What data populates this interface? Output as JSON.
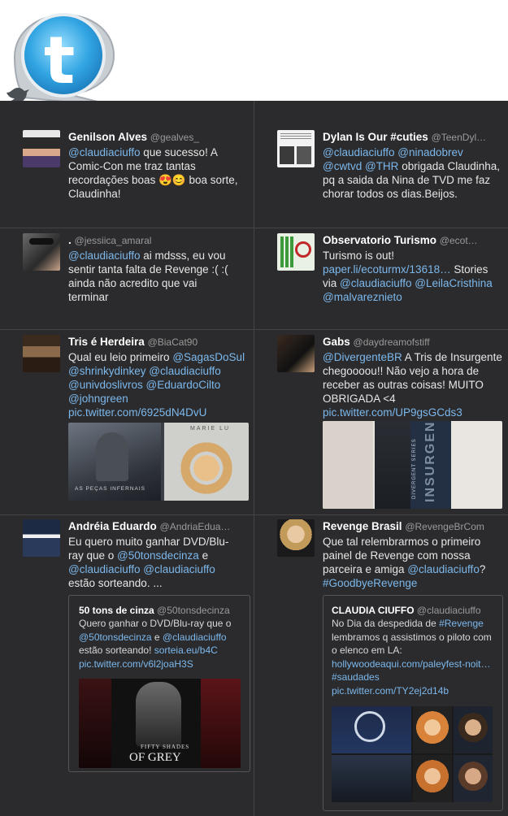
{
  "tweets": [
    {
      "name": "Genilson Alves",
      "handle": "@gealves_",
      "parts": [
        [
          "m",
          "@claudiaciuffo"
        ],
        [
          "t",
          " que sucesso! A Comic-Con me traz tantas recordações boas "
        ],
        [
          "t",
          "😍😊"
        ],
        [
          "t",
          " boa sorte, Claudinha!"
        ]
      ]
    },
    {
      "name": "Dylan Is Our #cuties",
      "handle": "@TeenDyl…",
      "parts": [
        [
          "m",
          "@claudiaciuffo"
        ],
        [
          "t",
          " "
        ],
        [
          "m",
          "@ninadobrev"
        ],
        [
          "t",
          " "
        ],
        [
          "m",
          "@cwtvd"
        ],
        [
          "t",
          " "
        ],
        [
          "m",
          "@THR"
        ],
        [
          "t",
          " obrigada Claudinha, pq a saida da Nina de TVD me faz chorar todos os dias.Beijos."
        ]
      ]
    },
    {
      "name": ".",
      "handle": "@jessiica_amaral",
      "parts": [
        [
          "m",
          "@claudiaciuffo"
        ],
        [
          "t",
          " ai mdsss, eu vou sentir tanta falta de Revenge :( :( ainda não acredito que vai terminar"
        ]
      ]
    },
    {
      "name": "Observatorio Turismo",
      "handle": "@ecot…",
      "parts": [
        [
          "t",
          "Turismo is out! "
        ],
        [
          "m",
          "paper.li/ecoturmx/13618…"
        ],
        [
          "t",
          " Stories via "
        ],
        [
          "m",
          "@claudiaciuffo"
        ],
        [
          "t",
          " "
        ],
        [
          "m",
          "@LeilaCristhina"
        ],
        [
          "t",
          " "
        ],
        [
          "m",
          "@malvareznieto"
        ]
      ]
    },
    {
      "name": "Tris é Herdeira",
      "handle": "@BiaCat90",
      "parts": [
        [
          "t",
          "Qual eu leio primeiro "
        ],
        [
          "m",
          "@SagasDoSul"
        ],
        [
          "t",
          " "
        ],
        [
          "m",
          "@shrinkydinkey"
        ],
        [
          "t",
          " "
        ],
        [
          "m",
          "@claudiaciuffo"
        ],
        [
          "t",
          " "
        ],
        [
          "m",
          "@univdoslivros"
        ],
        [
          "t",
          " "
        ],
        [
          "m",
          "@EduardoCilto"
        ],
        [
          "t",
          " "
        ],
        [
          "m",
          "@johngreen"
        ],
        [
          "t",
          " "
        ],
        [
          "m",
          "pic.twitter.com/6925dN4DvU"
        ]
      ],
      "image_text": [
        "AS PEÇAS INFERNAIS",
        "MARIE LU"
      ]
    },
    {
      "name": "Gabs",
      "handle": "@daydreamofstiff",
      "parts": [
        [
          "m",
          "@DivergenteBR"
        ],
        [
          "t",
          " A Tris de Insurgente chegoooou!! Não vejo a hora de receber as outras coisas! MUITO OBRIGADA <4 "
        ],
        [
          "m",
          "pic.twitter.com/UP9gsGCds3"
        ]
      ],
      "image_text": [
        "DIVERGENT SERIES",
        "INSURGENT"
      ]
    },
    {
      "name": "Andréia Eduardo",
      "handle": "@AndriaEdua…",
      "parts": [
        [
          "t",
          "Eu quero muito ganhar DVD/Blu-ray que o "
        ],
        [
          "m",
          "@50tonsdecinza"
        ],
        [
          "t",
          " e "
        ],
        [
          "m",
          "@claudiaciuffo"
        ],
        [
          "t",
          " "
        ],
        [
          "m",
          "@claudiaciuffo"
        ],
        [
          "t",
          "  estão sorteando. ..."
        ]
      ],
      "quote": {
        "name": "50 tons de cinza",
        "handle": "@50tonsdecinza",
        "parts": [
          [
            "t",
            "Quero ganhar o DVD/Blu-ray que o "
          ],
          [
            "m",
            "@50tonsdecinza"
          ],
          [
            "t",
            " e "
          ],
          [
            "m",
            "@claudiaciuffo"
          ],
          [
            "t",
            " estão sorteando! "
          ],
          [
            "m",
            "sorteia.eu/b4C"
          ],
          [
            "t",
            " "
          ],
          [
            "m",
            "pic.twitter.com/v6l2joaH3S"
          ]
        ],
        "image_text": [
          "FIFTY SHADES",
          "OF GREY"
        ]
      }
    },
    {
      "name": "Revenge Brasil",
      "handle": "@RevengeBrCom",
      "parts": [
        [
          "t",
          "Que tal relembrarmos o primeiro painel de Revenge com nossa parceira e amiga "
        ],
        [
          "m",
          "@claudiaciuffo"
        ],
        [
          "t",
          "? "
        ],
        [
          "m",
          "#GoodbyeRevenge"
        ]
      ],
      "quote": {
        "name": "CLAUDIA CIUFFO",
        "handle": "@claudiaciuffo",
        "parts": [
          [
            "t",
            "No Dia da despedida de "
          ],
          [
            "m",
            "#Revenge"
          ],
          [
            "t",
            " lembramos q assistimos o piloto com o elenco em LA: "
          ],
          [
            "m",
            "hollywoodeaqui.com/paleyfest-noit…"
          ],
          [
            "t",
            " "
          ],
          [
            "m",
            "#saudades"
          ],
          [
            "t",
            " "
          ],
          [
            "m",
            "pic.twitter.com/TY2ej2d14b"
          ]
        ]
      }
    }
  ],
  "colors": {
    "background": "#2b2b2d",
    "link": "#7cb8ec",
    "divider": "#444444",
    "brand": "#4fb3e8"
  },
  "icons": [
    "twitter-logo-icon",
    "twitter-bird-icon"
  ]
}
